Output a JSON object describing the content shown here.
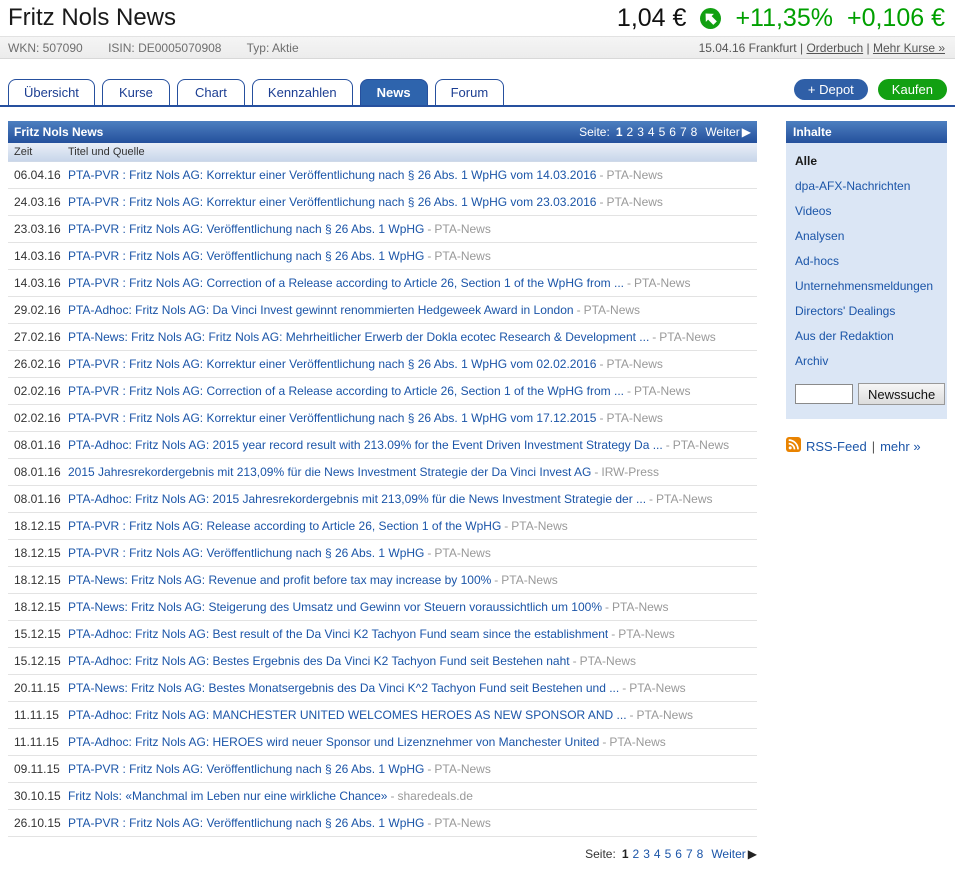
{
  "colors": {
    "accent_blue": "#26509e",
    "panel_gradient_top": "#4d7fc0",
    "panel_gradient_bottom": "#24509c",
    "link_blue": "#1b55a8",
    "positive_green": "#00a000",
    "buy_green": "#12a012",
    "source_gray": "#999999",
    "sidebar_bg": "#dbe6f5"
  },
  "header": {
    "title": "Fritz Nols News",
    "price": "1,04 €",
    "trend_icon": "up-arrow-circle-icon",
    "change_percent": "+11,35%",
    "change_abs": "+0,106 €"
  },
  "info_strip": {
    "wkn": "WKN: 507090",
    "isin": "ISIN: DE0005070908",
    "typ": "Typ: Aktie",
    "date_exchange": "15.04.16 Frankfurt",
    "divider": "|",
    "orderbuch_link": "Orderbuch",
    "mehr_kurse_link": "Mehr Kurse »"
  },
  "tabs": [
    {
      "label": "Übersicht",
      "active": false
    },
    {
      "label": "Kurse",
      "active": false
    },
    {
      "label": "Chart",
      "active": false
    },
    {
      "label": "Kennzahlen",
      "active": false
    },
    {
      "label": "News",
      "active": true
    },
    {
      "label": "Forum",
      "active": false
    }
  ],
  "actions": {
    "depot_label": "+ Depot",
    "buy_label": "Kaufen"
  },
  "news": {
    "panel_title": "Fritz Nols News",
    "columns": {
      "zeit": "Zeit",
      "titel": "Titel und Quelle"
    },
    "source_separator": "-",
    "pagination": {
      "label": "Seite:",
      "pages": [
        "1",
        "2",
        "3",
        "4",
        "5",
        "6",
        "7",
        "8"
      ],
      "current": "1",
      "next_label": "Weiter",
      "next_arrow": "▶"
    },
    "rows": [
      {
        "date": "06.04.16",
        "title": "PTA-PVR : Fritz Nols AG: Korrektur einer Veröffentlichung nach § 26 Abs. 1 WpHG vom 14.03.2016",
        "source": "PTA-News"
      },
      {
        "date": "24.03.16",
        "title": "PTA-PVR : Fritz Nols AG: Korrektur einer Veröffentlichung nach § 26 Abs. 1 WpHG vom 23.03.2016",
        "source": "PTA-News"
      },
      {
        "date": "23.03.16",
        "title": "PTA-PVR : Fritz Nols AG: Veröffentlichung nach § 26 Abs. 1 WpHG",
        "source": "PTA-News"
      },
      {
        "date": "14.03.16",
        "title": "PTA-PVR : Fritz Nols AG: Veröffentlichung nach § 26 Abs. 1 WpHG",
        "source": "PTA-News"
      },
      {
        "date": "14.03.16",
        "title": "PTA-PVR : Fritz Nols AG: Correction of a Release according to Article 26, Section 1 of the WpHG from ...",
        "source": "PTA-News"
      },
      {
        "date": "29.02.16",
        "title": "PTA-Adhoc: Fritz Nols AG: Da Vinci Invest gewinnt renommierten Hedgeweek Award in London",
        "source": "PTA-News"
      },
      {
        "date": "27.02.16",
        "title": "PTA-News: Fritz Nols AG: Fritz Nols AG: Mehrheitlicher Erwerb der Dokla ecotec Research & Development ...",
        "source": "PTA-News"
      },
      {
        "date": "26.02.16",
        "title": "PTA-PVR : Fritz Nols AG: Korrektur einer Veröffentlichung nach § 26 Abs. 1 WpHG vom 02.02.2016",
        "source": "PTA-News"
      },
      {
        "date": "02.02.16",
        "title": "PTA-PVR : Fritz Nols AG: Correction of a Release according to Article 26, Section 1 of the WpHG from ...",
        "source": "PTA-News"
      },
      {
        "date": "02.02.16",
        "title": "PTA-PVR : Fritz Nols AG: Korrektur einer Veröffentlichung nach § 26 Abs. 1 WpHG vom 17.12.2015",
        "source": "PTA-News"
      },
      {
        "date": "08.01.16",
        "title": "PTA-Adhoc: Fritz Nols AG: 2015 year record result with 213.09% for the Event Driven Investment Strategy Da ...",
        "source": "PTA-News"
      },
      {
        "date": "08.01.16",
        "title": "2015 Jahresrekordergebnis mit 213,09% für die News Investment Strategie der Da Vinci Invest AG",
        "source": "IRW-Press"
      },
      {
        "date": "08.01.16",
        "title": "PTA-Adhoc: Fritz Nols AG: 2015 Jahresrekordergebnis mit 213,09% für die News Investment Strategie der ...",
        "source": "PTA-News"
      },
      {
        "date": "18.12.15",
        "title": "PTA-PVR : Fritz Nols AG: Release according to Article 26, Section 1 of the WpHG",
        "source": "PTA-News"
      },
      {
        "date": "18.12.15",
        "title": "PTA-PVR : Fritz Nols AG: Veröffentlichung nach § 26 Abs. 1 WpHG",
        "source": "PTA-News"
      },
      {
        "date": "18.12.15",
        "title": "PTA-News: Fritz Nols AG: Revenue and profit before tax may increase by 100%",
        "source": "PTA-News"
      },
      {
        "date": "18.12.15",
        "title": "PTA-News: Fritz Nols AG: Steigerung des Umsatz und Gewinn vor Steuern voraussichtlich um 100%",
        "source": "PTA-News"
      },
      {
        "date": "15.12.15",
        "title": "PTA-Adhoc: Fritz Nols AG: Best result of the Da Vinci K2 Tachyon Fund seam since the establishment",
        "source": "PTA-News"
      },
      {
        "date": "15.12.15",
        "title": "PTA-Adhoc: Fritz Nols AG: Bestes Ergebnis des Da Vinci K2 Tachyon Fund seit Bestehen naht",
        "source": "PTA-News"
      },
      {
        "date": "20.11.15",
        "title": "PTA-News: Fritz Nols AG: Bestes Monatsergebnis des Da Vinci K^2 Tachyon Fund seit Bestehen und ...",
        "source": "PTA-News"
      },
      {
        "date": "11.11.15",
        "title": "PTA-Adhoc: Fritz Nols AG: MANCHESTER UNITED WELCOMES HEROES AS NEW SPONSOR AND ...",
        "source": "PTA-News"
      },
      {
        "date": "11.11.15",
        "title": "PTA-Adhoc: Fritz Nols AG: HEROES wird neuer Sponsor und Lizenznehmer von Manchester United",
        "source": "PTA-News"
      },
      {
        "date": "09.11.15",
        "title": "PTA-PVR : Fritz Nols AG: Veröffentlichung nach § 26 Abs. 1 WpHG",
        "source": "PTA-News"
      },
      {
        "date": "30.10.15",
        "title": "Fritz Nols: «Manchmal im Leben nur eine wirkliche Chance»",
        "source": "sharedeals.de"
      },
      {
        "date": "26.10.15",
        "title": "PTA-PVR : Fritz Nols AG: Veröffentlichung nach § 26 Abs. 1 WpHG",
        "source": "PTA-News"
      }
    ]
  },
  "sidebar": {
    "title": "Inhalte",
    "items": [
      {
        "label": "Alle",
        "active": true
      },
      {
        "label": "dpa-AFX-Nachrichten",
        "active": false
      },
      {
        "label": "Videos",
        "active": false
      },
      {
        "label": "Analysen",
        "active": false
      },
      {
        "label": "Ad-hocs",
        "active": false
      },
      {
        "label": "Unternehmensmeldungen",
        "active": false
      },
      {
        "label": "Directors' Dealings",
        "active": false
      },
      {
        "label": "Aus der Redaktion",
        "active": false
      },
      {
        "label": "Archiv",
        "active": false
      }
    ],
    "search": {
      "value": "",
      "button_label": "Newssuche"
    },
    "rss": {
      "icon": "rss-icon",
      "feed_label": "RSS-Feed",
      "divider": "|",
      "more_label": "mehr »"
    }
  }
}
